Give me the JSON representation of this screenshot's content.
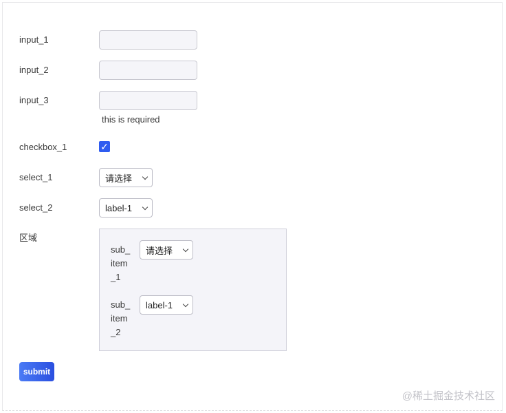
{
  "form": {
    "fields": [
      {
        "label": "input_1",
        "value": ""
      },
      {
        "label": "input_2",
        "value": ""
      },
      {
        "label": "input_3",
        "value": "",
        "hint": "this is required"
      }
    ],
    "checkbox_1": {
      "label": "checkbox_1",
      "checked": true,
      "mark": "✓"
    },
    "select_1": {
      "label": "select_1",
      "value": "请选择"
    },
    "select_2": {
      "label": "select_2",
      "value": "label-1"
    },
    "region": {
      "label": "区域",
      "sub_items": [
        {
          "label": "sub_item_1",
          "value": "请选择"
        },
        {
          "label": "sub_item_2",
          "value": "label-1"
        }
      ]
    },
    "submit_label": "submit"
  },
  "watermark": "@稀土掘金技术社区",
  "colors": {
    "accent": "#2f5cf0",
    "group_bg": "#f4f4f9"
  }
}
